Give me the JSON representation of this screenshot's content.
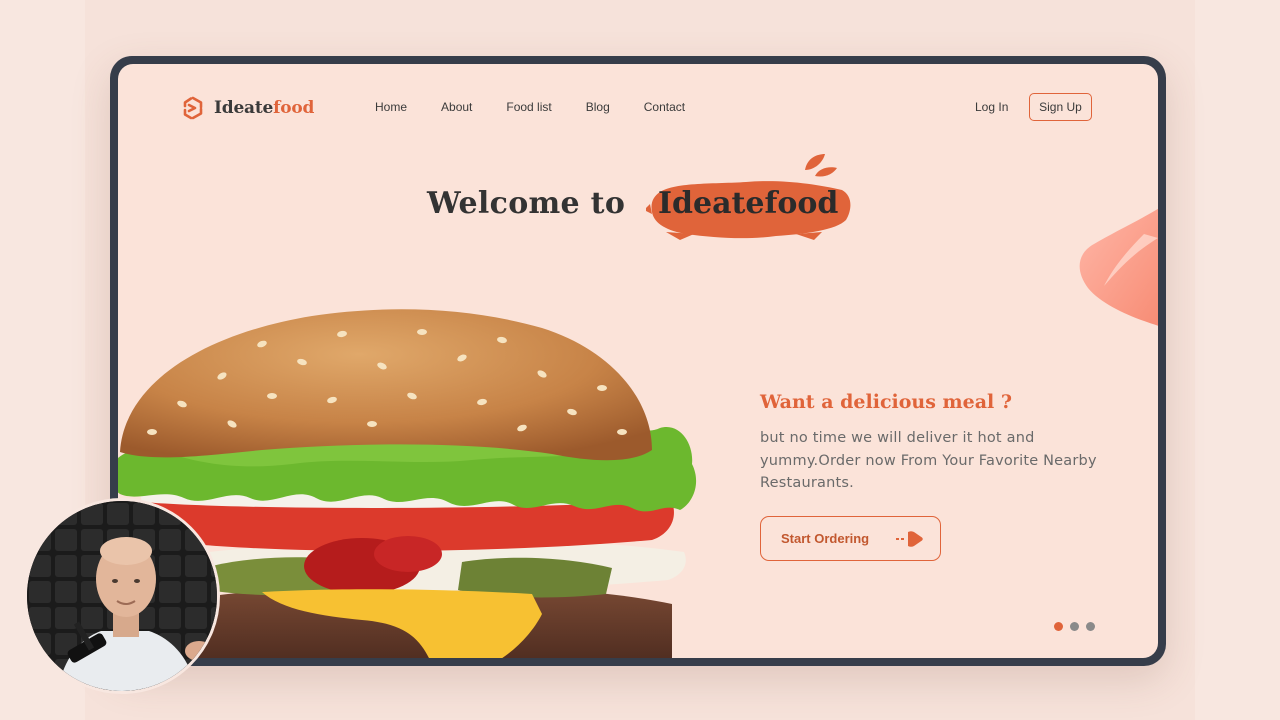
{
  "brand": {
    "name_part1": "Ideate",
    "name_part2": "food",
    "icon": "logo-mark-icon"
  },
  "nav": {
    "items": [
      "Home",
      "About",
      "Food list",
      "Blog",
      "Contact"
    ]
  },
  "auth": {
    "login_label": "Log In",
    "signup_label": "Sign Up"
  },
  "hero": {
    "welcome": "Welcome to",
    "brand": "Ideatefood",
    "headline": "Want a delicious meal ?",
    "description": "but no time we will deliver it hot and yummy.Order now From Your Favorite Nearby Restaurants.",
    "cta_label": "Start Ordering",
    "cta_icon": "play-arrow-icon"
  },
  "carousel": {
    "slides": 3,
    "active": 1
  },
  "colors": {
    "accent": "#e0643a",
    "background": "#fbe3d9",
    "frame": "#363d4a",
    "text": "#333333"
  }
}
